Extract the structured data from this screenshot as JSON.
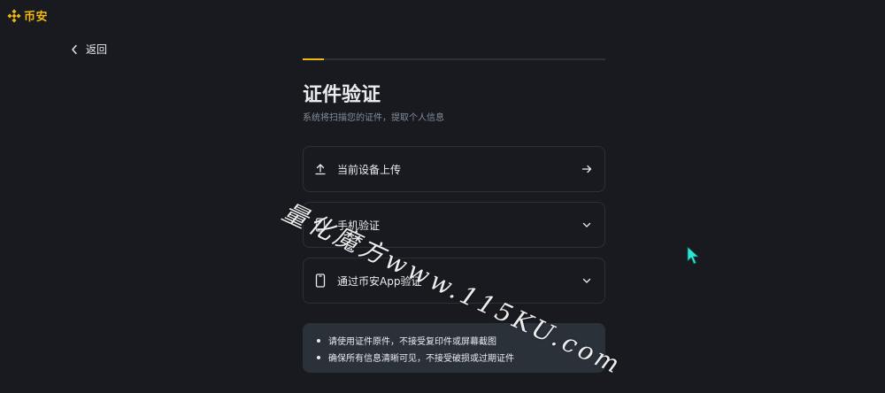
{
  "brand": {
    "logo_text": "币安",
    "accent": "#f0b90b"
  },
  "nav": {
    "back_label": "返回"
  },
  "progress": {
    "fraction": 0.07
  },
  "header": {
    "title": "证件验证",
    "subtitle": "系统将扫描您的证件，提取个人信息"
  },
  "options": [
    {
      "label": "当前设备上传",
      "icon": "upload-icon",
      "trailing": "arrow-right-icon"
    },
    {
      "label": "手机验证",
      "icon": "phone-icon",
      "trailing": "chevron-down-icon"
    },
    {
      "label": "通过币安App验证",
      "icon": "phone-icon",
      "trailing": "chevron-down-icon"
    }
  ],
  "notes": [
    "请使用证件原件，不接受复印件或屏幕截图",
    "确保所有信息清晰可见，不接受破损或过期证件"
  ],
  "watermark": {
    "text": "量化魔方www.115KU.com"
  },
  "colors": {
    "background": "#181a20",
    "card_border": "#2b3139",
    "muted_text": "#848e9c",
    "cursor": "#2ee6d6"
  }
}
